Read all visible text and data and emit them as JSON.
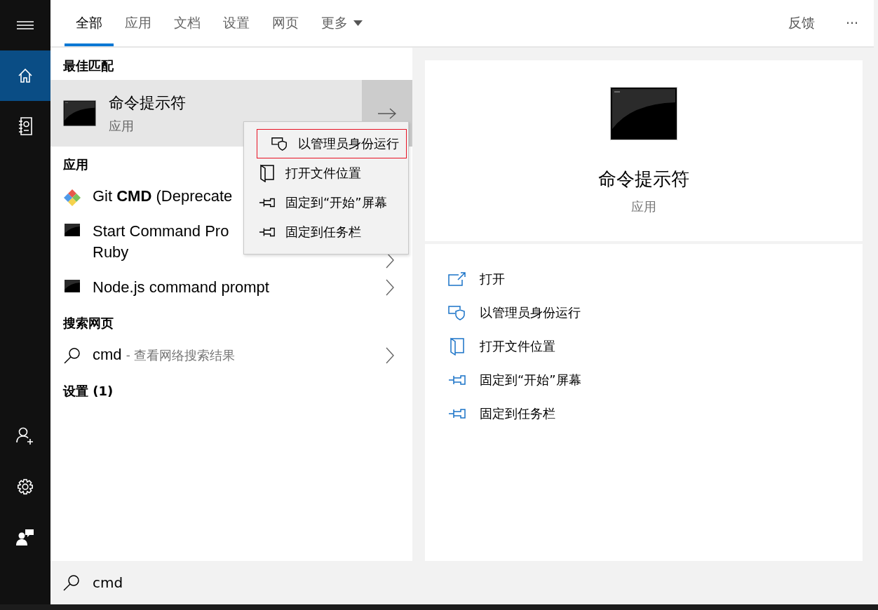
{
  "sidebar": {
    "top_items": [
      {
        "kind": "menu",
        "selected": false
      },
      {
        "kind": "home",
        "selected": true
      },
      {
        "kind": "notebook",
        "selected": false
      }
    ],
    "bottom_items": [
      {
        "kind": "person-add",
        "selected": false
      },
      {
        "kind": "settings",
        "selected": false
      },
      {
        "kind": "feedback",
        "selected": false
      }
    ]
  },
  "tabs": [
    {
      "label": "全部",
      "selected": true,
      "dropdown": false
    },
    {
      "label": "应用",
      "selected": false,
      "dropdown": false
    },
    {
      "label": "文档",
      "selected": false,
      "dropdown": false
    },
    {
      "label": "设置",
      "selected": false,
      "dropdown": false
    },
    {
      "label": "网页",
      "selected": false,
      "dropdown": false
    },
    {
      "label": "更多",
      "selected": false,
      "dropdown": true
    }
  ],
  "top_actions": [
    "反馈",
    "···"
  ],
  "best_match": {
    "heading": "最佳匹配",
    "title": "命令提示符",
    "subtitle": "应用",
    "selected": true
  },
  "apps": {
    "heading": "应用",
    "items": [
      {
        "kind": "git",
        "lines": [
          "Git **CMD** (Deprecate"
        ],
        "chevron": false
      },
      {
        "kind": "console",
        "lines": [
          "Start Command Pro",
          "Ruby"
        ],
        "chevron": true
      },
      {
        "kind": "console",
        "lines": [
          "Node.js command prompt"
        ],
        "chevron": true
      }
    ]
  },
  "web_search": {
    "heading": "搜索网页",
    "items": [
      {
        "query": "cmd",
        "hint": "- 查看网络搜索结果",
        "chevron": true
      }
    ]
  },
  "settings": {
    "heading": "设置 (1)"
  },
  "preview": {
    "title": "命令提示符",
    "subtitle": "应用",
    "actions": [
      {
        "kind": "open",
        "label": "打开"
      },
      {
        "kind": "admin",
        "label": "以管理员身份运行"
      },
      {
        "kind": "folder",
        "label": "打开文件位置"
      },
      {
        "kind": "pin",
        "label": "固定到“开始”屏幕"
      },
      {
        "kind": "pin",
        "label": "固定到任务栏"
      }
    ]
  },
  "context_menu": {
    "items": [
      {
        "kind": "admin",
        "label": "以管理员身份运行",
        "focused": true
      },
      {
        "kind": "folder",
        "label": "打开文件位置",
        "focused": false
      },
      {
        "kind": "pin",
        "label": "固定到“开始”屏幕",
        "focused": false
      },
      {
        "kind": "pin",
        "label": "固定到任务栏",
        "focused": false
      }
    ]
  },
  "search": {
    "value": "cmd"
  }
}
